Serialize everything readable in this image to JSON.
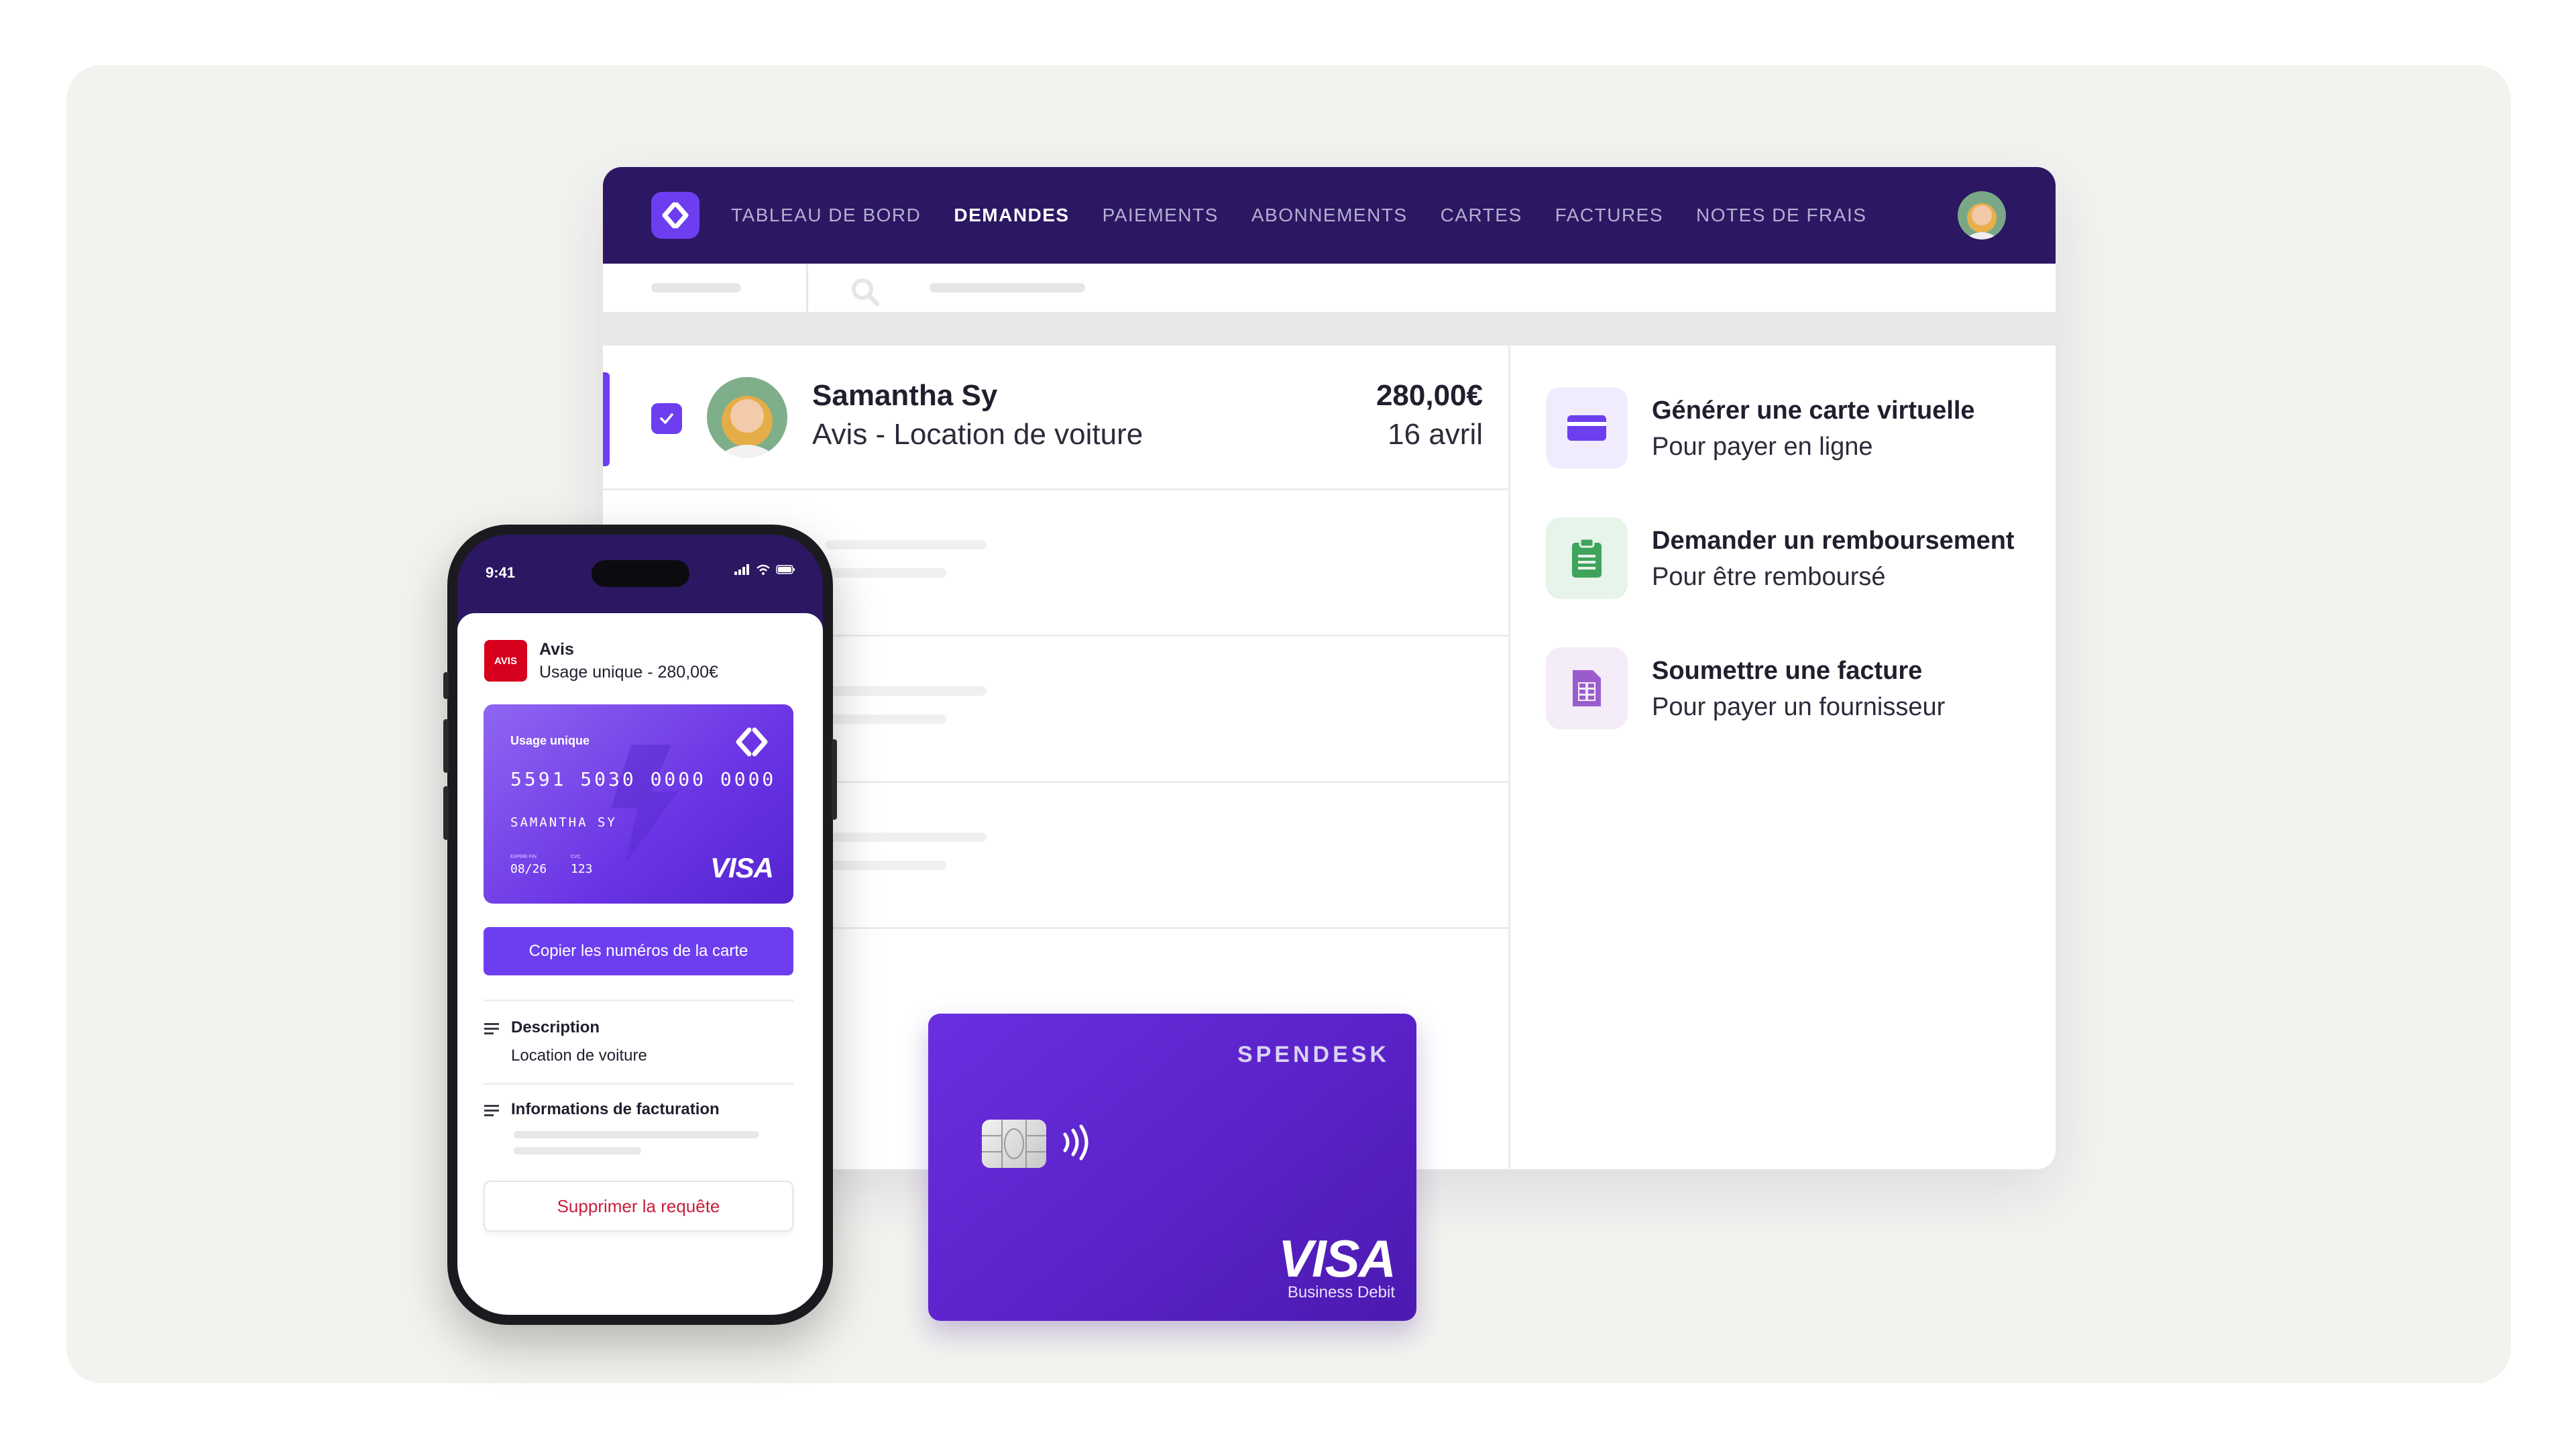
{
  "nav": {
    "items": [
      {
        "label": "TABLEAU DE BORD",
        "active": false
      },
      {
        "label": "DEMANDES",
        "active": true
      },
      {
        "label": "PAIEMENTS",
        "active": false
      },
      {
        "label": "ABONNEMENTS",
        "active": false
      },
      {
        "label": "CARTES",
        "active": false
      },
      {
        "label": "FACTURES",
        "active": false
      },
      {
        "label": "NOTES DE FRAIS",
        "active": false
      }
    ]
  },
  "requests": {
    "selected": {
      "name": "Samantha Sy",
      "description": "Avis - Location de voiture",
      "amount": "280,00€",
      "date": "16 avril",
      "checked": true
    }
  },
  "actions": [
    {
      "title": "Générer une carte virtuelle",
      "subtitle": "Pour payer en ligne",
      "icon": "credit-card-icon",
      "color": "#6d3ef0"
    },
    {
      "title": "Demander un remboursement",
      "subtitle": "Pour être remboursé",
      "icon": "clipboard-icon",
      "color": "#3fa45b"
    },
    {
      "title": "Soumettre une facture",
      "subtitle": "Pour payer un fournisseur",
      "icon": "invoice-icon",
      "color": "#9a5ccc"
    }
  ],
  "physical_card": {
    "brand": "SPENDESK",
    "network": "VISA",
    "network_sub": "Business Debit"
  },
  "phone": {
    "status_time": "9:41",
    "merchant": {
      "logo_text": "AVIS",
      "name": "Avis",
      "subtitle": "Usage unique - 280,00€"
    },
    "virtual_card": {
      "label": "Usage unique",
      "number": "5591 5030 0000 0000",
      "holder": "SAMANTHA SY",
      "expiry_label": "EXPIRE FIN",
      "expiry": "08/26",
      "cvc_label": "CVC",
      "cvc": "123",
      "network": "VISA"
    },
    "copy_button": "Copier les numéros de la carte",
    "description": {
      "title": "Description",
      "value": "Location de voiture"
    },
    "billing": {
      "title": "Informations de facturation"
    },
    "delete_button": "Supprimer la requête"
  },
  "colors": {
    "topbar": "#2c1763",
    "accent": "#6d3ef0",
    "danger": "#c81e3c"
  }
}
